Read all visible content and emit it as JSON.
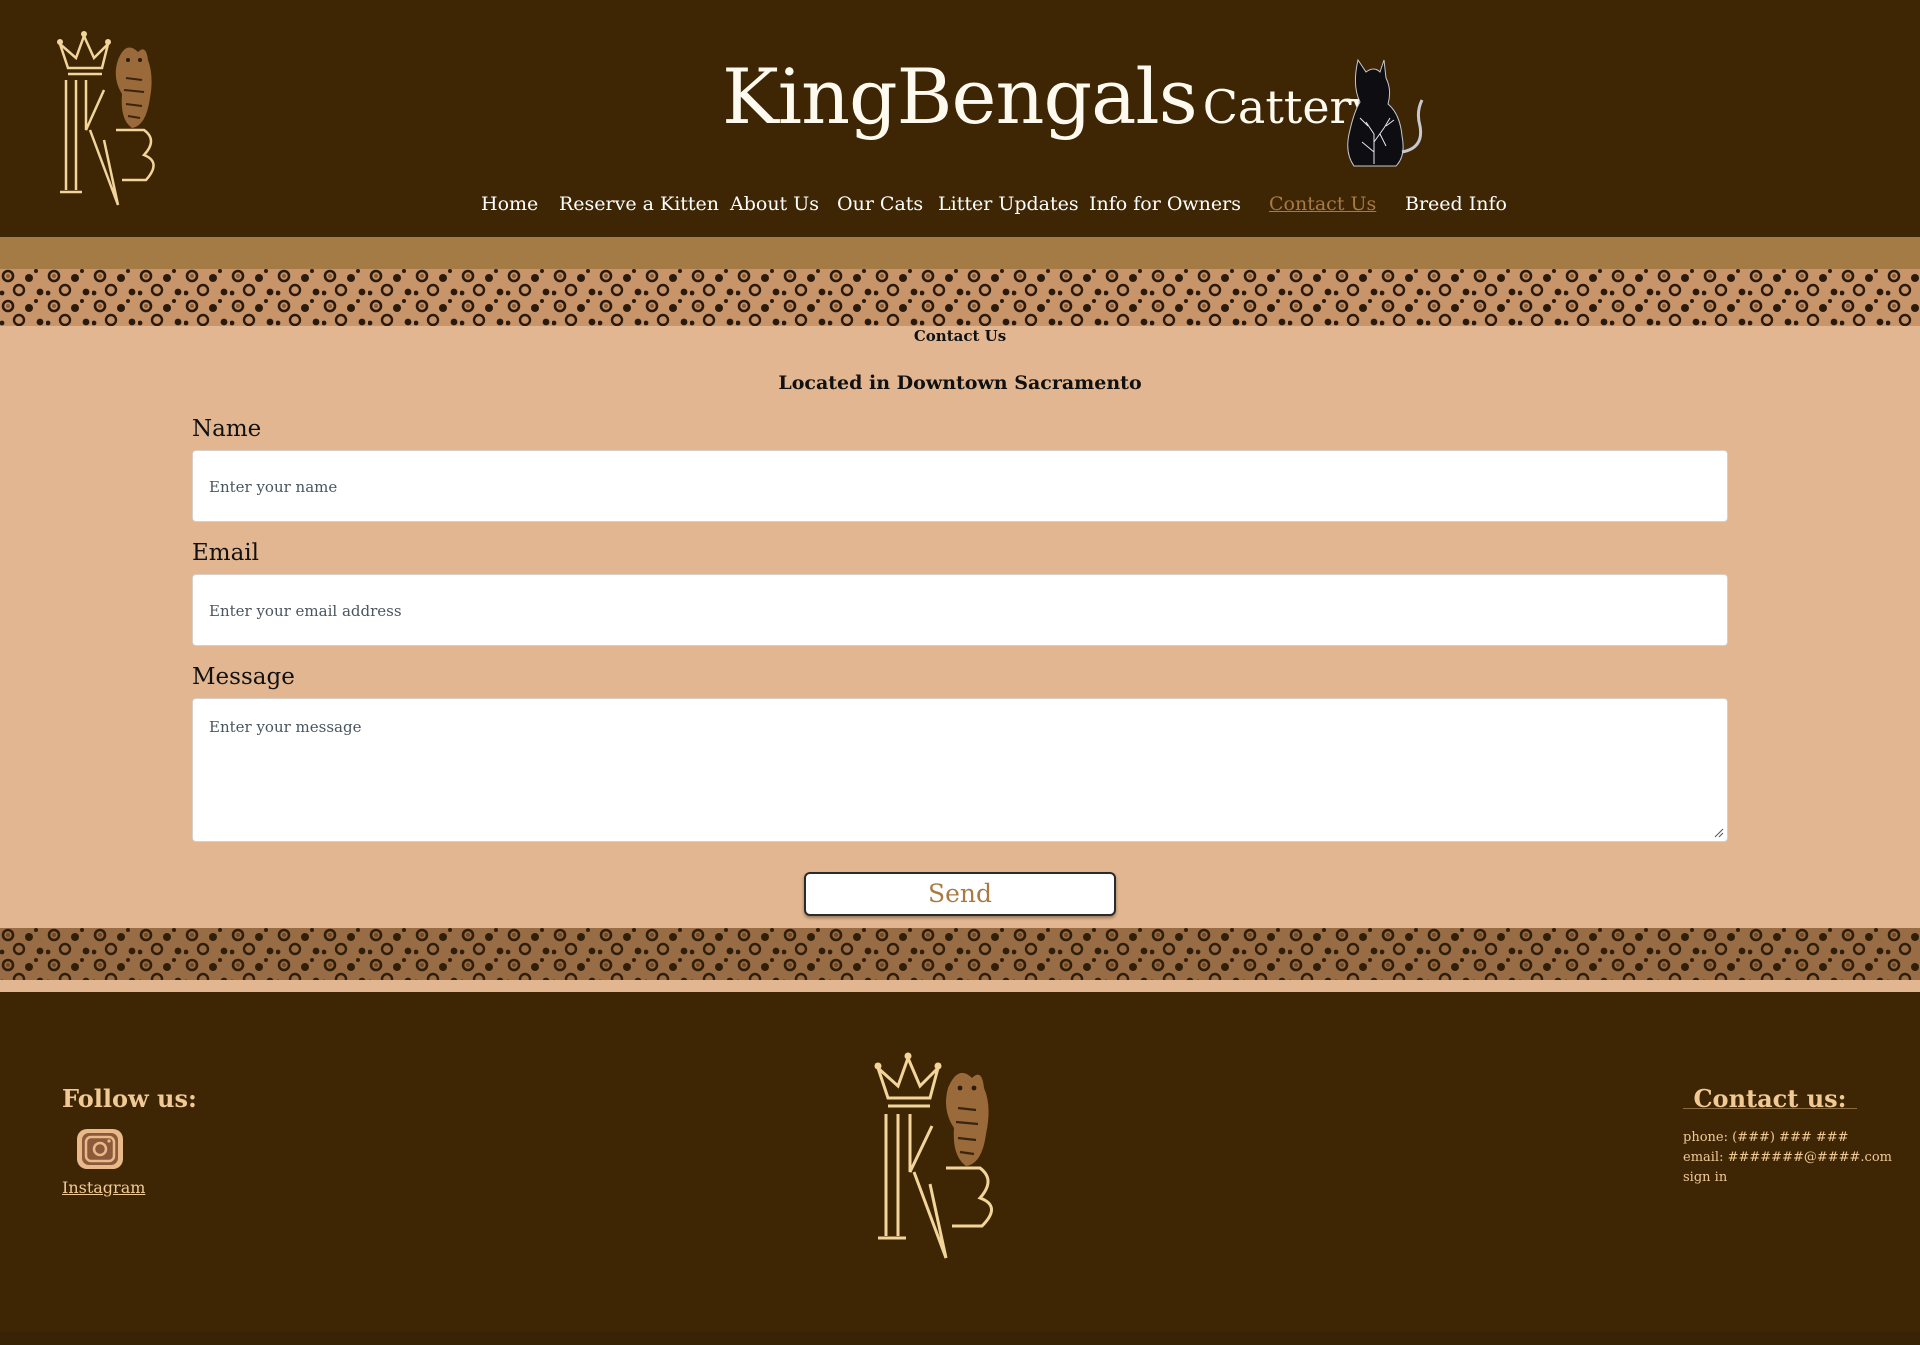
{
  "header": {
    "title_main": "KingBengals",
    "title_sub": "Cattery",
    "logo_icon": "kb-crown-logo-icon",
    "cat_icon": "cat-silhouette-icon"
  },
  "nav": {
    "items": [
      {
        "label": "Home"
      },
      {
        "label": "Reserve a Kitten"
      },
      {
        "label": "About Us"
      },
      {
        "label": "Our Cats"
      },
      {
        "label": "Litter Updates"
      },
      {
        "label": "Info for Owners"
      },
      {
        "label": "Contact Us",
        "active": true
      },
      {
        "label": "Breed Info"
      }
    ]
  },
  "main": {
    "heading": "Contact Us",
    "location": "Located in Downtown Sacramento",
    "form": {
      "name_label": "Name",
      "name_placeholder": "Enter your name",
      "email_label": "Email",
      "email_placeholder": "Enter your email address",
      "message_label": "Message",
      "message_placeholder": "Enter your message",
      "send_label": "Send"
    }
  },
  "footer": {
    "follow_title": "Follow us:",
    "instagram_label": "Instagram",
    "contact_title": "Contact us:",
    "phone": "phone: (###) ### ###",
    "email": "email: #######@####.com",
    "sign_in": "sign in"
  },
  "colors": {
    "header_bg": "#3e2605",
    "tan_band": "#a57b45",
    "main_bg": "#e2b690",
    "accent": "#a97b43",
    "footer_text": "#f0c995"
  }
}
